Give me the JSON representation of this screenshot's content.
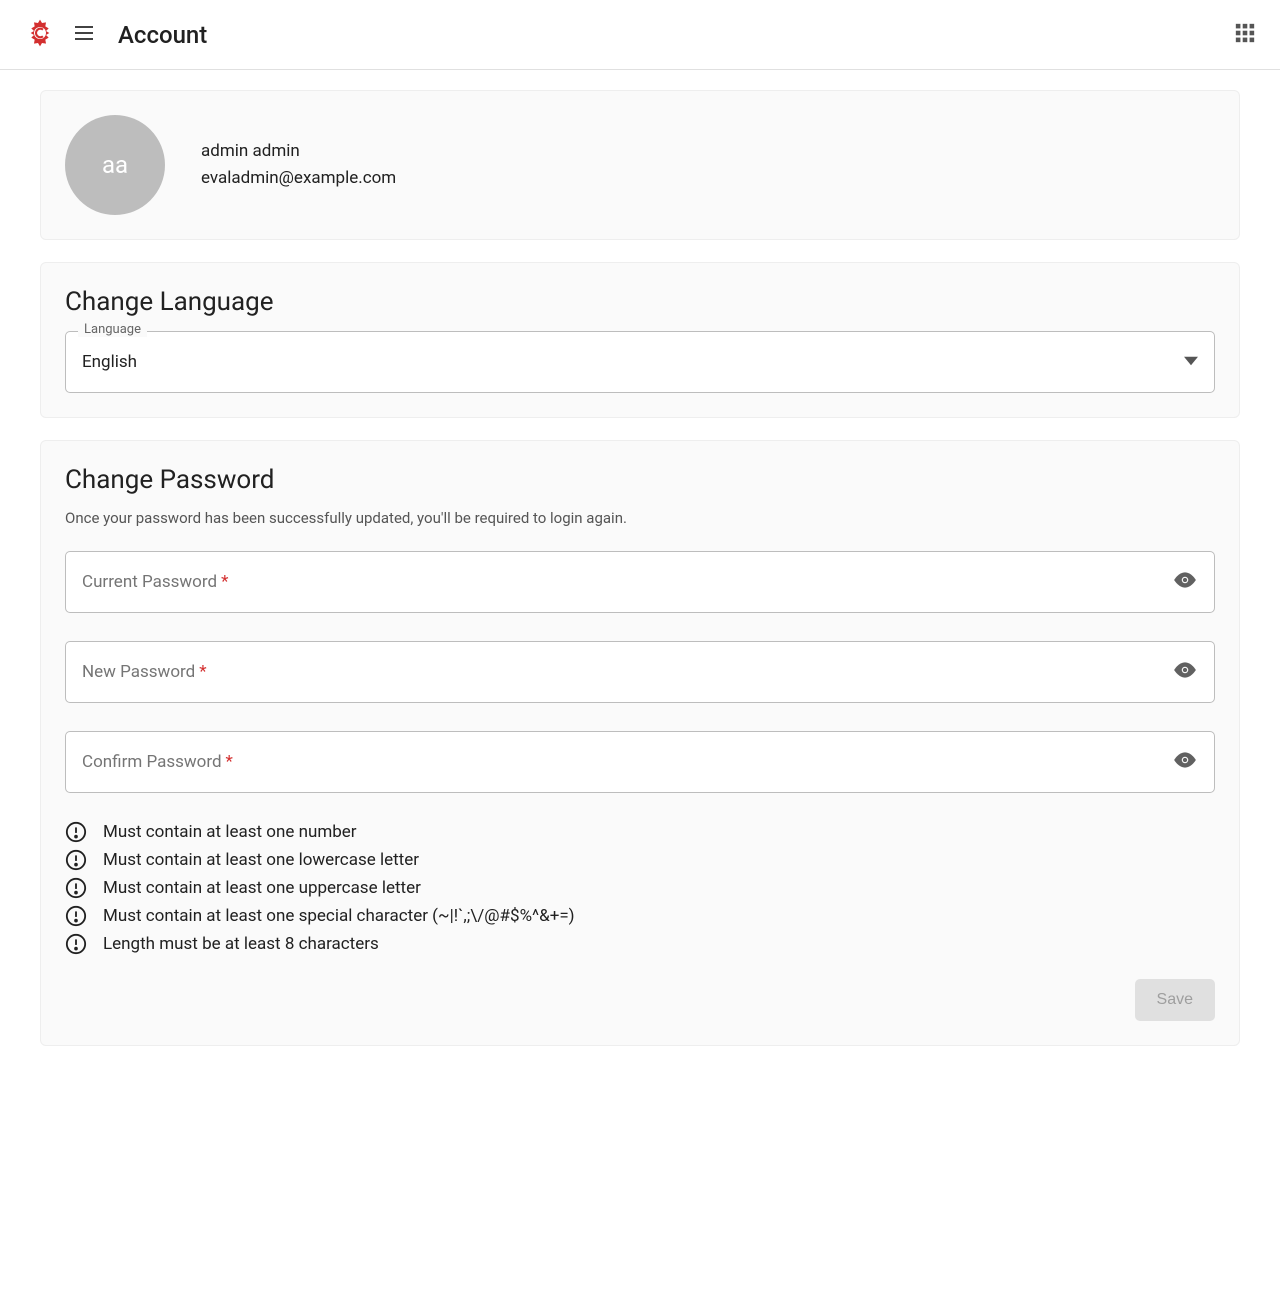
{
  "header": {
    "title": "Account"
  },
  "profile": {
    "avatar_initials": "aa",
    "name": "admin admin",
    "email": "evaladmin@example.com"
  },
  "language": {
    "section_title": "Change Language",
    "field_label": "Language",
    "selected": "English"
  },
  "password": {
    "section_title": "Change Password",
    "subtitle": "Once your password has been successfully updated, you'll be required to login again.",
    "current_label": "Current Password",
    "new_label": "New Password",
    "confirm_label": "Confirm Password",
    "rules": [
      "Must contain at least one number",
      "Must contain at least one lowercase letter",
      "Must contain at least one uppercase letter",
      "Must contain at least one special character (~|!`,;\\/@#$%^&+=)",
      "Length must be at least 8 characters"
    ],
    "save_label": "Save"
  }
}
